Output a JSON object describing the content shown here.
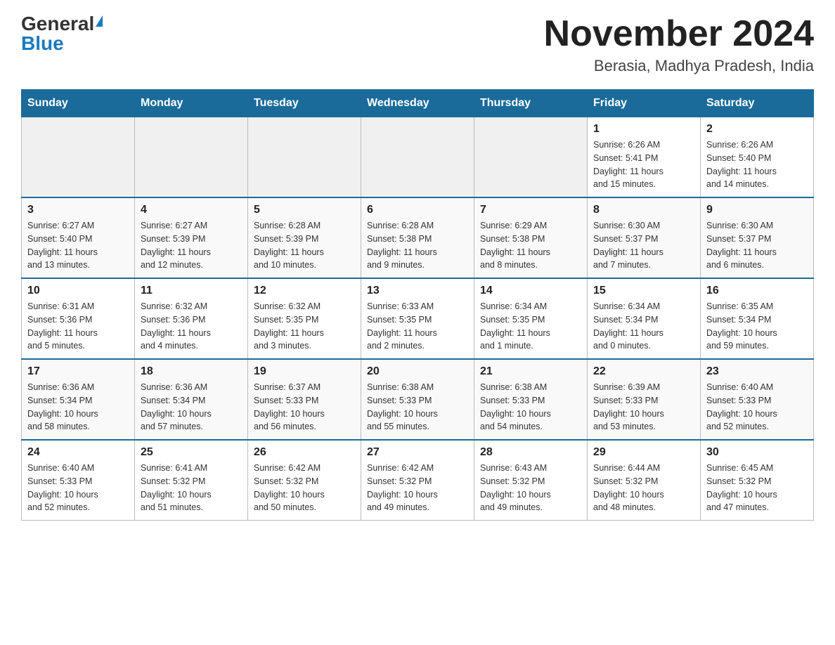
{
  "header": {
    "logo_general": "General",
    "logo_blue": "Blue",
    "month_year": "November 2024",
    "location": "Berasia, Madhya Pradesh, India"
  },
  "days_of_week": [
    "Sunday",
    "Monday",
    "Tuesday",
    "Wednesday",
    "Thursday",
    "Friday",
    "Saturday"
  ],
  "weeks": [
    [
      {
        "day": "",
        "info": ""
      },
      {
        "day": "",
        "info": ""
      },
      {
        "day": "",
        "info": ""
      },
      {
        "day": "",
        "info": ""
      },
      {
        "day": "",
        "info": ""
      },
      {
        "day": "1",
        "info": "Sunrise: 6:26 AM\nSunset: 5:41 PM\nDaylight: 11 hours\nand 15 minutes."
      },
      {
        "day": "2",
        "info": "Sunrise: 6:26 AM\nSunset: 5:40 PM\nDaylight: 11 hours\nand 14 minutes."
      }
    ],
    [
      {
        "day": "3",
        "info": "Sunrise: 6:27 AM\nSunset: 5:40 PM\nDaylight: 11 hours\nand 13 minutes."
      },
      {
        "day": "4",
        "info": "Sunrise: 6:27 AM\nSunset: 5:39 PM\nDaylight: 11 hours\nand 12 minutes."
      },
      {
        "day": "5",
        "info": "Sunrise: 6:28 AM\nSunset: 5:39 PM\nDaylight: 11 hours\nand 10 minutes."
      },
      {
        "day": "6",
        "info": "Sunrise: 6:28 AM\nSunset: 5:38 PM\nDaylight: 11 hours\nand 9 minutes."
      },
      {
        "day": "7",
        "info": "Sunrise: 6:29 AM\nSunset: 5:38 PM\nDaylight: 11 hours\nand 8 minutes."
      },
      {
        "day": "8",
        "info": "Sunrise: 6:30 AM\nSunset: 5:37 PM\nDaylight: 11 hours\nand 7 minutes."
      },
      {
        "day": "9",
        "info": "Sunrise: 6:30 AM\nSunset: 5:37 PM\nDaylight: 11 hours\nand 6 minutes."
      }
    ],
    [
      {
        "day": "10",
        "info": "Sunrise: 6:31 AM\nSunset: 5:36 PM\nDaylight: 11 hours\nand 5 minutes."
      },
      {
        "day": "11",
        "info": "Sunrise: 6:32 AM\nSunset: 5:36 PM\nDaylight: 11 hours\nand 4 minutes."
      },
      {
        "day": "12",
        "info": "Sunrise: 6:32 AM\nSunset: 5:35 PM\nDaylight: 11 hours\nand 3 minutes."
      },
      {
        "day": "13",
        "info": "Sunrise: 6:33 AM\nSunset: 5:35 PM\nDaylight: 11 hours\nand 2 minutes."
      },
      {
        "day": "14",
        "info": "Sunrise: 6:34 AM\nSunset: 5:35 PM\nDaylight: 11 hours\nand 1 minute."
      },
      {
        "day": "15",
        "info": "Sunrise: 6:34 AM\nSunset: 5:34 PM\nDaylight: 11 hours\nand 0 minutes."
      },
      {
        "day": "16",
        "info": "Sunrise: 6:35 AM\nSunset: 5:34 PM\nDaylight: 10 hours\nand 59 minutes."
      }
    ],
    [
      {
        "day": "17",
        "info": "Sunrise: 6:36 AM\nSunset: 5:34 PM\nDaylight: 10 hours\nand 58 minutes."
      },
      {
        "day": "18",
        "info": "Sunrise: 6:36 AM\nSunset: 5:34 PM\nDaylight: 10 hours\nand 57 minutes."
      },
      {
        "day": "19",
        "info": "Sunrise: 6:37 AM\nSunset: 5:33 PM\nDaylight: 10 hours\nand 56 minutes."
      },
      {
        "day": "20",
        "info": "Sunrise: 6:38 AM\nSunset: 5:33 PM\nDaylight: 10 hours\nand 55 minutes."
      },
      {
        "day": "21",
        "info": "Sunrise: 6:38 AM\nSunset: 5:33 PM\nDaylight: 10 hours\nand 54 minutes."
      },
      {
        "day": "22",
        "info": "Sunrise: 6:39 AM\nSunset: 5:33 PM\nDaylight: 10 hours\nand 53 minutes."
      },
      {
        "day": "23",
        "info": "Sunrise: 6:40 AM\nSunset: 5:33 PM\nDaylight: 10 hours\nand 52 minutes."
      }
    ],
    [
      {
        "day": "24",
        "info": "Sunrise: 6:40 AM\nSunset: 5:33 PM\nDaylight: 10 hours\nand 52 minutes."
      },
      {
        "day": "25",
        "info": "Sunrise: 6:41 AM\nSunset: 5:32 PM\nDaylight: 10 hours\nand 51 minutes."
      },
      {
        "day": "26",
        "info": "Sunrise: 6:42 AM\nSunset: 5:32 PM\nDaylight: 10 hours\nand 50 minutes."
      },
      {
        "day": "27",
        "info": "Sunrise: 6:42 AM\nSunset: 5:32 PM\nDaylight: 10 hours\nand 49 minutes."
      },
      {
        "day": "28",
        "info": "Sunrise: 6:43 AM\nSunset: 5:32 PM\nDaylight: 10 hours\nand 49 minutes."
      },
      {
        "day": "29",
        "info": "Sunrise: 6:44 AM\nSunset: 5:32 PM\nDaylight: 10 hours\nand 48 minutes."
      },
      {
        "day": "30",
        "info": "Sunrise: 6:45 AM\nSunset: 5:32 PM\nDaylight: 10 hours\nand 47 minutes."
      }
    ]
  ]
}
